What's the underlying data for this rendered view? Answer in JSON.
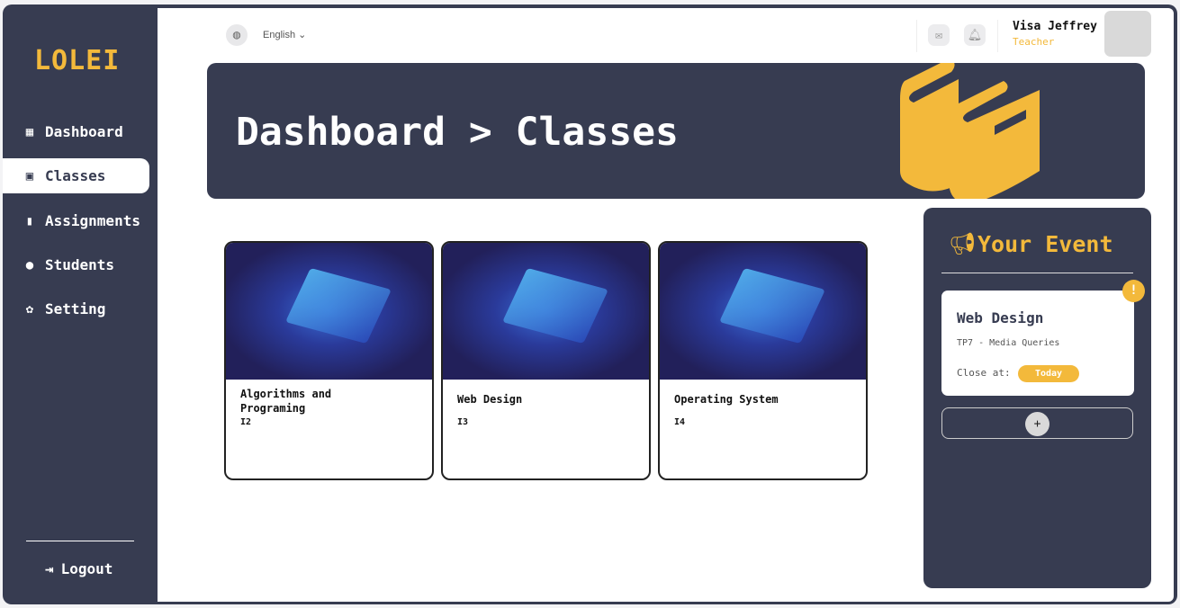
{
  "brand": "LOLEI",
  "sidebar": {
    "items": [
      {
        "label": "Dashboard",
        "icon": "dashboard-icon"
      },
      {
        "label": "Classes",
        "icon": "backpack-icon"
      },
      {
        "label": "Assignments",
        "icon": "file-icon"
      },
      {
        "label": "Students",
        "icon": "users-icon"
      },
      {
        "label": "Setting",
        "icon": "gear-icon"
      }
    ],
    "logout": "Logout"
  },
  "header": {
    "language": "English",
    "user_name": "Visa Jeffrey",
    "user_role": "Teacher"
  },
  "banner": {
    "title": "Dashboard > Classes"
  },
  "classes": [
    {
      "name": "Algorithms and Programing",
      "code": "I2"
    },
    {
      "name": "Web Design",
      "code": "I3"
    },
    {
      "name": "Operating System",
      "code": "I4"
    }
  ],
  "events": {
    "title": "Your Event",
    "items": [
      {
        "name": "Web Design",
        "subtitle": "TP7 - Media Queries",
        "close_label": "Close at:",
        "close_value": "Today",
        "alert": "!"
      }
    ],
    "add_label": "+"
  },
  "colors": {
    "dark": "#373c51",
    "accent": "#f3b93b"
  }
}
